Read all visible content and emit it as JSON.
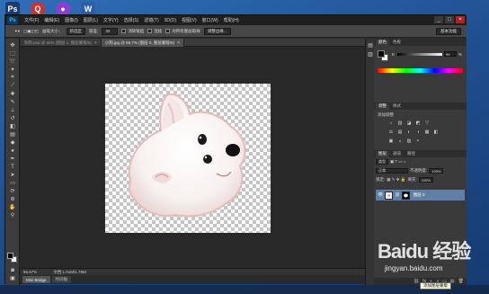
{
  "desktop_icons": [
    {
      "name": "photoshop-desktop-icon",
      "glyph": "Ps",
      "color": "#1b3d6b"
    },
    {
      "name": "qq-desktop-icon",
      "glyph": "Q",
      "color": "#c9342c"
    },
    {
      "name": "purple-app-desktop-icon",
      "glyph": "●",
      "color": "#8a3fd1"
    },
    {
      "name": "word-desktop-icon",
      "glyph": "W",
      "color": "#2b5ea8"
    }
  ],
  "menubar": {
    "logo": "Ps",
    "items": [
      "文件(F)",
      "编辑(E)",
      "图像(I)",
      "图层(L)",
      "文字(Y)",
      "选择(S)",
      "滤镜(T)",
      "3D(D)",
      "视图(V)",
      "窗口(W)",
      "帮助(H)"
    ],
    "window_controls": [
      "_",
      "□",
      "×"
    ]
  },
  "options_bar": {
    "brush_size_label": "画笔大小：",
    "mode_value": "新选区",
    "tolerance_label": "容差:",
    "tolerance_value": "32",
    "antialias_label": "消除锯齿",
    "contiguous_label": "连续",
    "sample_all_label": "对所有图层取样",
    "refine_edge_label": "调整边缘...",
    "workspace_value": "基本功能"
  },
  "document_tabs": [
    {
      "label": "狗狗.psd @ 50% (图层 1, 图层蒙版/8)",
      "active": false
    },
    {
      "label": "小狗.jpg @ 66.7% (图层 0, 图层蒙版/8)",
      "active": true
    }
  ],
  "status_bar": {
    "zoom": "66.67%",
    "doc_size": "文档:1.01M/1.78M"
  },
  "bottom_tabs": [
    {
      "label": "Mini Bridge",
      "active": true
    },
    {
      "label": "时间轴",
      "active": false
    }
  ],
  "color_panel": {
    "tabs": [
      "颜色",
      "色板"
    ],
    "k_label": "K",
    "k_value": "99",
    "unit": "%"
  },
  "adjustments_panel": {
    "tabs": [
      "调整",
      "样式"
    ],
    "title": "添加调整",
    "icons": [
      "☼",
      "▥",
      "◪",
      "◩",
      "▽",
      "⚖",
      "▤",
      "◐",
      "◑",
      "▦",
      "◧",
      "▣",
      "◒",
      "▨",
      "◓"
    ]
  },
  "layers_panel": {
    "tabs": [
      "图层",
      "通道",
      "路径"
    ],
    "filter_value": "类型",
    "blend_mode": "正常",
    "opacity_label": "不透明度:",
    "opacity_value": "100%",
    "lock_label": "锁定:",
    "fill_label": "填充:",
    "fill_value": "100%",
    "layer": {
      "name": "图层 0",
      "visible": true
    },
    "footer_icons": [
      "⛓",
      "fx",
      "◐",
      "◑",
      "▭",
      "▤",
      "🗑"
    ]
  },
  "watermark": {
    "logo": "Baidu 经验",
    "url": "jingyan.baidu.com"
  },
  "tooltip": "添加图层蒙版"
}
